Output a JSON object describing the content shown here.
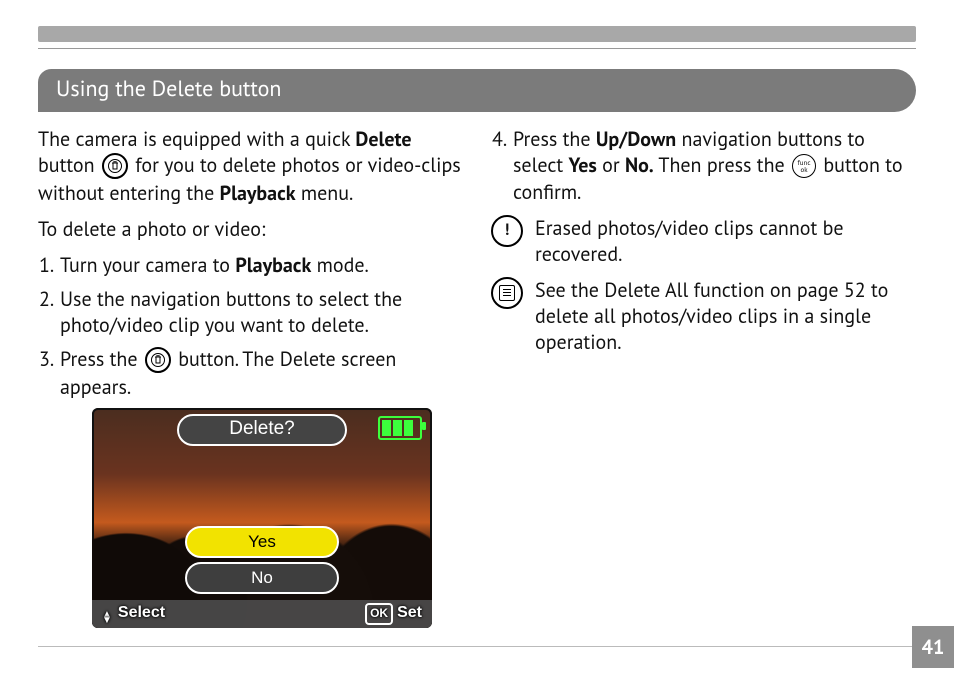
{
  "page_number": "41",
  "section_title": "Using the Delete button",
  "intro": {
    "seg1": "The camera is equipped with a quick ",
    "bold1": "Delete",
    "seg2": " button ",
    "seg3": " for you to delete photos or video-clips without entering the ",
    "bold2": "Playback",
    "seg4": " menu."
  },
  "lead": "To delete a photo or video:",
  "steps": {
    "s1a": "Turn your camera to ",
    "s1b": "Playback",
    "s1c": " mode.",
    "s2": "Use the navigation buttons to select the photo/video clip you want to delete.",
    "s3a": "Press the ",
    "s3b": " button. The Delete screen appears.",
    "s4a": "Press the ",
    "s4b": "Up/Down",
    "s4c": " navigation buttons to select ",
    "s4d": "Yes",
    "s4e": " or ",
    "s4f": "No.",
    "s4g": " Then press the ",
    "s4h": " button to confirm."
  },
  "lcd": {
    "title": "Delete?",
    "yes": "Yes",
    "no": "No",
    "select": "Select",
    "ok": "OK",
    "set": "Set"
  },
  "notes": {
    "warn": "Erased photos/video clips cannot be recovered.",
    "info": "See the Delete All function on page 52 to delete all photos/video clips in a single operation."
  },
  "icons": {
    "trash": "trash-icon",
    "func": "func\nok"
  }
}
